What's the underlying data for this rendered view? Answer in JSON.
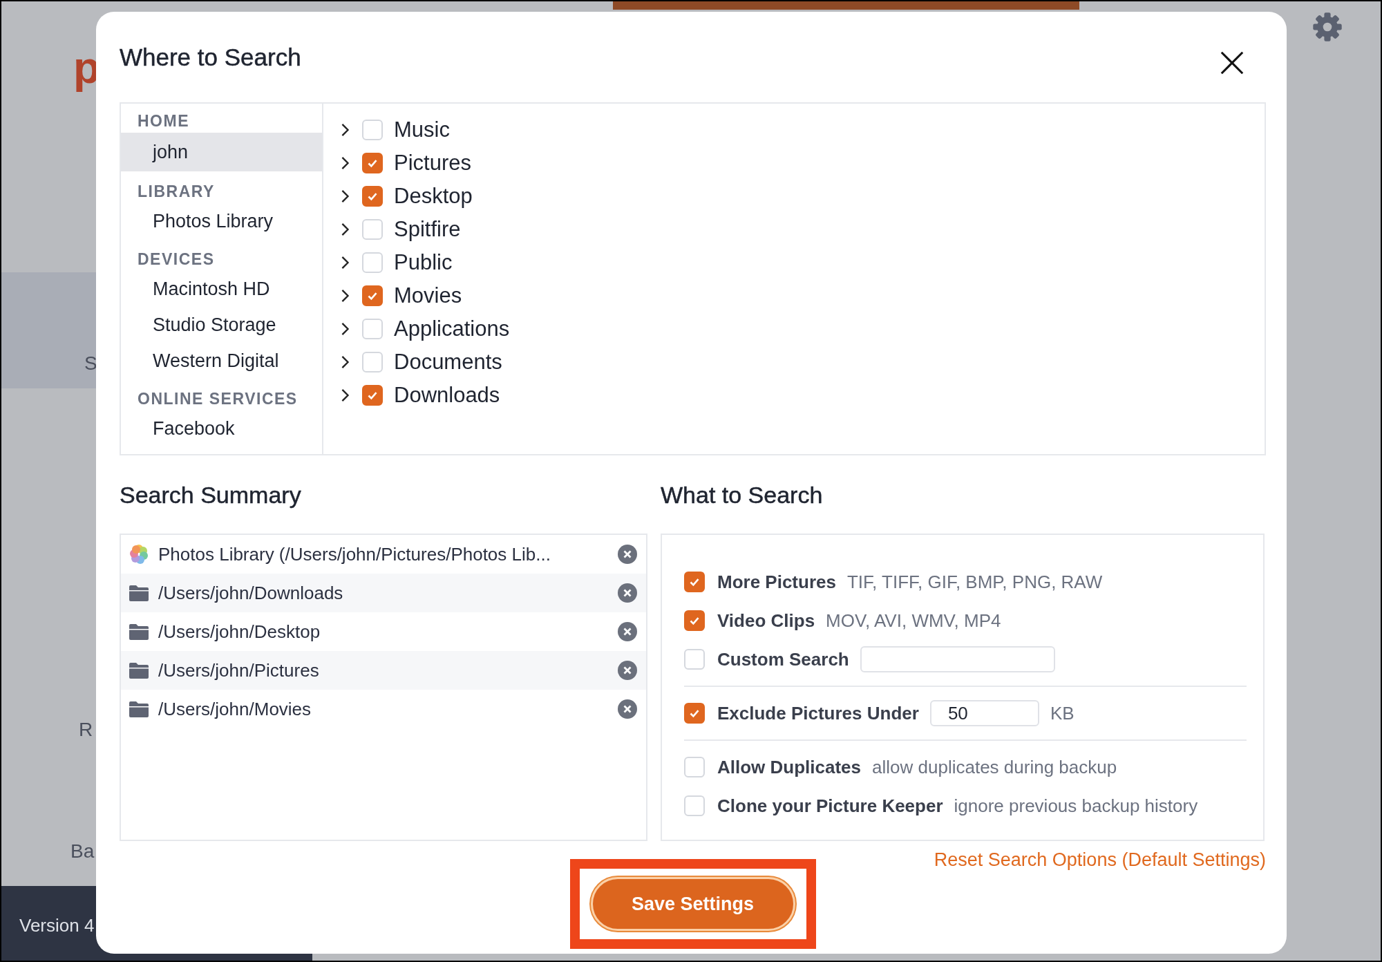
{
  "background": {
    "logo": "p",
    "labels": [
      "S",
      "R",
      "Ba"
    ],
    "version": "Version 4"
  },
  "dialog": {
    "title": "Where to Search",
    "sidebar": [
      {
        "header": "HOME",
        "items": [
          {
            "label": "john",
            "selected": true
          }
        ]
      },
      {
        "header": "LIBRARY",
        "items": [
          {
            "label": "Photos Library",
            "selected": false
          }
        ]
      },
      {
        "header": "DEVICES",
        "items": [
          {
            "label": "Macintosh HD",
            "selected": false
          },
          {
            "label": "Studio Storage",
            "selected": false
          },
          {
            "label": "Western Digital",
            "selected": false
          }
        ]
      },
      {
        "header": "ONLINE SERVICES",
        "items": [
          {
            "label": "Facebook",
            "selected": false
          }
        ]
      }
    ],
    "folders": [
      {
        "name": "Music",
        "checked": false,
        "expanded": false
      },
      {
        "name": "Pictures",
        "checked": true,
        "expanded": false
      },
      {
        "name": "Desktop",
        "checked": true,
        "expanded": false
      },
      {
        "name": "Spitfire",
        "checked": false,
        "expanded": false
      },
      {
        "name": "Public",
        "checked": false,
        "expanded": false
      },
      {
        "name": "Movies",
        "checked": true,
        "expanded": false
      },
      {
        "name": "Applications",
        "checked": false,
        "expanded": false
      },
      {
        "name": "Documents",
        "checked": false,
        "expanded": false
      },
      {
        "name": "Downloads",
        "checked": true,
        "expanded": false
      }
    ],
    "summary": {
      "title": "Search Summary",
      "items": [
        {
          "kind": "photos",
          "path": "Photos Library (/Users/john/Pictures/Photos Lib..."
        },
        {
          "kind": "folder",
          "path": "/Users/john/Downloads"
        },
        {
          "kind": "folder",
          "path": "/Users/john/Desktop"
        },
        {
          "kind": "folder",
          "path": "/Users/john/Pictures"
        },
        {
          "kind": "folder",
          "path": "/Users/john/Movies"
        }
      ]
    },
    "options": {
      "title": "What to Search",
      "groups": [
        [
          {
            "kind": "check",
            "label": "More Pictures",
            "hint": "TIF, TIFF, GIF, BMP, PNG, RAW",
            "checked": true
          },
          {
            "kind": "check",
            "label": "Video Clips",
            "hint": "MOV, AVI, WMV, MP4",
            "checked": true
          },
          {
            "kind": "text",
            "label": "Custom Search",
            "checked": false
          }
        ],
        [
          {
            "kind": "size",
            "label": "Exclude Pictures Under",
            "value": "50",
            "unit": "KB",
            "checked": true
          }
        ],
        [
          {
            "kind": "check",
            "label": "Allow Duplicates",
            "hint": "allow duplicates during backup",
            "checked": false
          },
          {
            "kind": "check",
            "label": "Clone your Picture Keeper",
            "hint": "ignore previous backup history",
            "checked": false
          }
        ]
      ]
    },
    "reset_link": "Reset Search Options (Default Settings)",
    "save_button": "Save Settings"
  }
}
